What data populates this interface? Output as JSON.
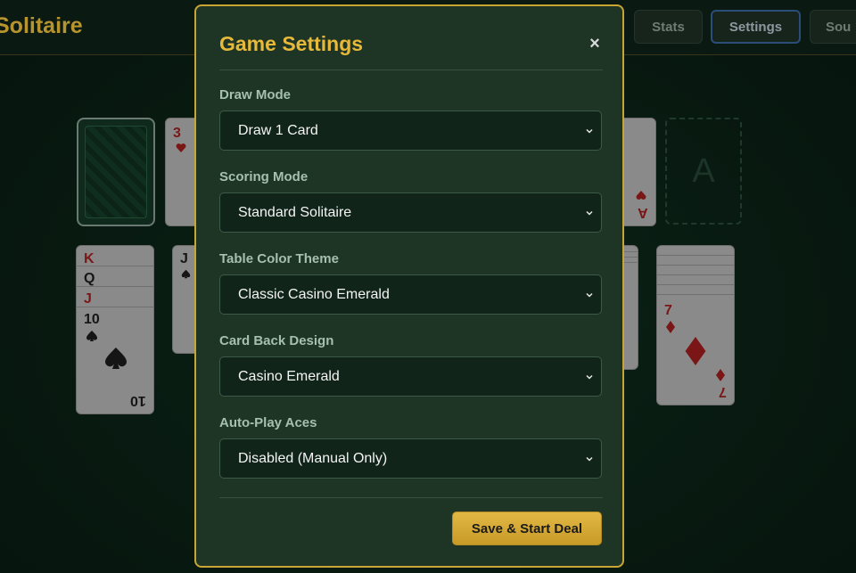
{
  "header": {
    "app_title": "Solitaire",
    "buttons": {
      "stats": "Stats",
      "settings": "Settings",
      "sound": "Sou"
    }
  },
  "table": {
    "waste_card": {
      "rank": "3",
      "suit": "heart"
    },
    "foundation_card": {
      "rank": "A",
      "suit": "heart"
    },
    "empty_foundation_label": "A",
    "tableau": [
      {
        "ranks": [
          "K",
          "Q",
          "J",
          "10"
        ],
        "top_suit": "spade"
      },
      {
        "ranks": [
          "J"
        ],
        "top_suit": "spade"
      },
      {
        "ranks": [
          "7"
        ],
        "top_suit": "diamond"
      }
    ]
  },
  "modal": {
    "title": "Game Settings",
    "close_label": "×",
    "fields": {
      "draw_mode": {
        "label": "Draw Mode",
        "value": "Draw 1 Card"
      },
      "scoring_mode": {
        "label": "Scoring Mode",
        "value": "Standard Solitaire"
      },
      "table_theme": {
        "label": "Table Color Theme",
        "value": "Classic Casino Emerald"
      },
      "card_back": {
        "label": "Card Back Design",
        "value": "Casino Emerald"
      },
      "auto_play": {
        "label": "Auto-Play Aces",
        "value": "Disabled (Manual Only)"
      }
    },
    "save_label": "Save & Start Deal"
  },
  "colors": {
    "accent_gold": "#e7b93a",
    "modal_bg": "#1e3424",
    "table_bg": "#0b2418"
  }
}
